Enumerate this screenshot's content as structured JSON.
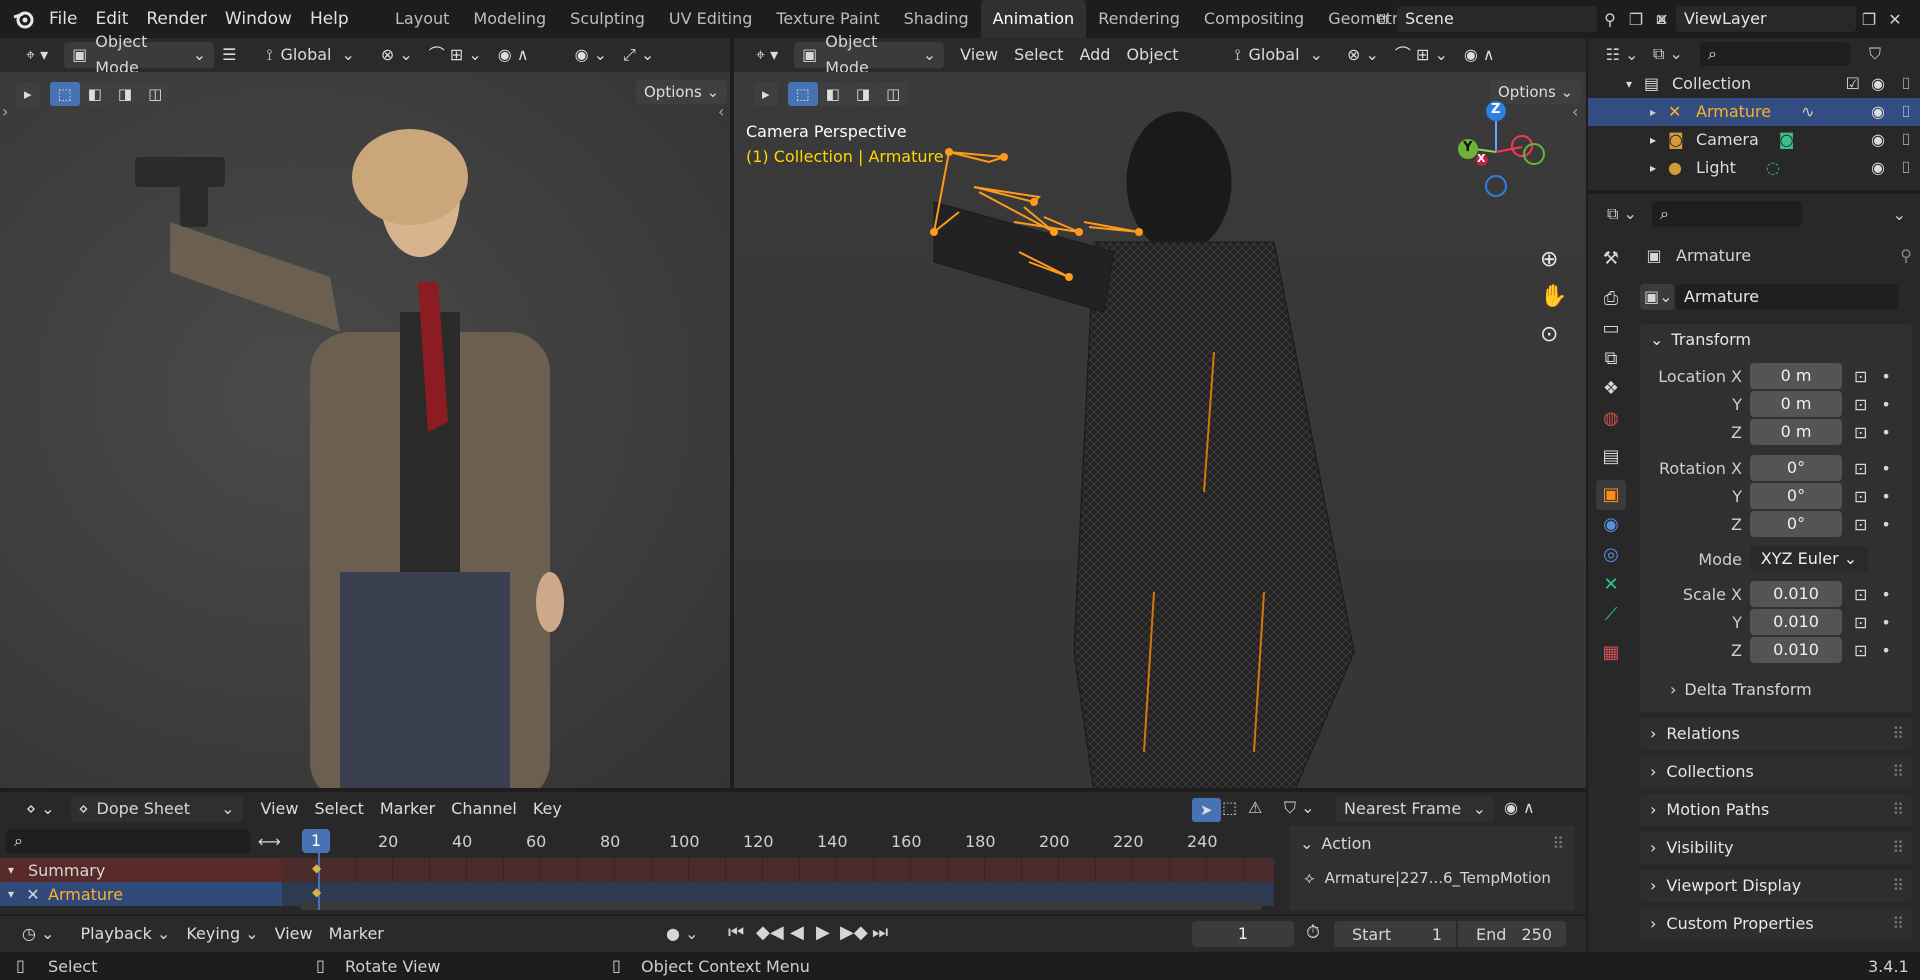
{
  "menu": {
    "file": "File",
    "edit": "Edit",
    "render": "Render",
    "window": "Window",
    "help": "Help"
  },
  "workspaces": [
    "Layout",
    "Modeling",
    "Sculpting",
    "UV Editing",
    "Texture Paint",
    "Shading",
    "Animation",
    "Rendering",
    "Compositing",
    "Geometry Noc"
  ],
  "scene_name": "Scene",
  "view_layer": "ViewLayer",
  "left_viewport": {
    "mode": "Object Mode",
    "orientation": "Global",
    "options": "Options"
  },
  "right_viewport": {
    "mode": "Object Mode",
    "menus": [
      "View",
      "Select",
      "Add",
      "Object"
    ],
    "orientation": "Global",
    "options": "Options",
    "camera_label": "Camera Perspective",
    "collection_label": "(1) Collection | Armature",
    "gizmo": {
      "z": "Z",
      "y": "Y",
      "x": "X"
    }
  },
  "outliner": {
    "collection": "Collection",
    "items": [
      {
        "name": "Armature",
        "selected": true
      },
      {
        "name": "Camera",
        "selected": false
      },
      {
        "name": "Light",
        "selected": false
      }
    ]
  },
  "properties": {
    "object_name": "Armature",
    "data_name": "Armature",
    "transform": "Transform",
    "location": {
      "label": "Location X",
      "x": "0 m",
      "y": "0 m",
      "z": "0 m"
    },
    "rotation": {
      "label": "Rotation X",
      "x": "0°",
      "y": "0°",
      "z": "0°"
    },
    "mode": {
      "label": "Mode",
      "value": "XYZ Euler"
    },
    "scale": {
      "label": "Scale X",
      "x": "0.010",
      "y": "0.010",
      "z": "0.010"
    },
    "axis_y": "Y",
    "axis_z": "Z",
    "panels": [
      "Delta Transform",
      "Relations",
      "Collections",
      "Motion Paths",
      "Visibility",
      "Viewport Display",
      "Custom Properties"
    ]
  },
  "dopesheet": {
    "editor": "Dope Sheet",
    "menus": [
      "View",
      "Select",
      "Marker",
      "Channel",
      "Key"
    ],
    "snap": "Nearest Frame",
    "current_frame_badge": "1",
    "ticks": [
      "20",
      "40",
      "60",
      "80",
      "100",
      "120",
      "140",
      "160",
      "180",
      "200",
      "220",
      "240"
    ],
    "channels": {
      "summary": "Summary",
      "armature": "Armature"
    },
    "action_title": "Action",
    "action_name": "Armature|227...6_TempMotion"
  },
  "timeline": {
    "playback": "Playback",
    "keying": "Keying",
    "view": "View",
    "marker": "Marker",
    "frame": "1",
    "start_label": "Start",
    "start": "1",
    "end_label": "End",
    "end": "250"
  },
  "status": {
    "select": "Select",
    "rotate": "Rotate View",
    "context": "Object Context Menu",
    "version": "3.4.1"
  },
  "colors": {
    "accent": "#4772b3",
    "selection_orange": "#ffaf29",
    "bg": "#1d1d1d"
  }
}
